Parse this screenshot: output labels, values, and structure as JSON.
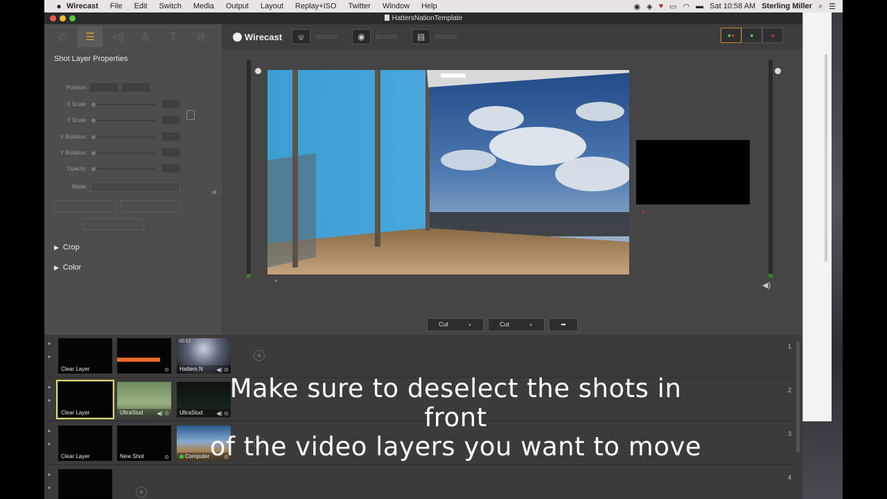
{
  "menubar": {
    "apple": "",
    "items": [
      "Wirecast",
      "File",
      "Edit",
      "Switch",
      "Media",
      "Output",
      "Layout",
      "Replay+ISO",
      "Twitter",
      "Window",
      "Help"
    ],
    "datetime": "Sat 10:58 AM",
    "user": "Sterling Miller"
  },
  "window": {
    "title": "HattersNationTemplate"
  },
  "properties": {
    "title": "Shot Layer Properties",
    "labels": [
      "Position",
      "X Scale",
      "Y Scale",
      "X Rotation",
      "Y Rotation",
      "Opacity",
      "Matte"
    ],
    "sections": [
      "Crop",
      "Color"
    ]
  },
  "toolbar": {
    "brand": "Wirecast",
    "stream_time": "00:00:00",
    "record_time": "00:00:00",
    "iso_time": "00:00:00"
  },
  "transitions": {
    "left": "Cut",
    "right": "Cut"
  },
  "shots": {
    "rows": [
      {
        "number": "1",
        "items": [
          {
            "label": "Clear Layer",
            "timestamp": ""
          },
          {
            "label": "",
            "timestamp": ""
          },
          {
            "label": "Hatters N",
            "timestamp": "00:12"
          }
        ]
      },
      {
        "number": "2",
        "items": [
          {
            "label": "Clear Layer",
            "selected": true
          },
          {
            "label": "UltraStud"
          },
          {
            "label": "UltraStud"
          }
        ]
      },
      {
        "number": "3",
        "items": [
          {
            "label": "Clear Layer"
          },
          {
            "label": "New Shot"
          },
          {
            "label": "Computer"
          }
        ]
      },
      {
        "number": "4",
        "items": [
          {
            "label": ""
          }
        ]
      }
    ]
  },
  "caption": {
    "line1": "Make sure to deselect the shots in front",
    "line2": "of the video layers you want to move"
  },
  "colors": {
    "accent": "#d7a23a",
    "selection": "#e2d66c",
    "window_bg": "#454545"
  }
}
